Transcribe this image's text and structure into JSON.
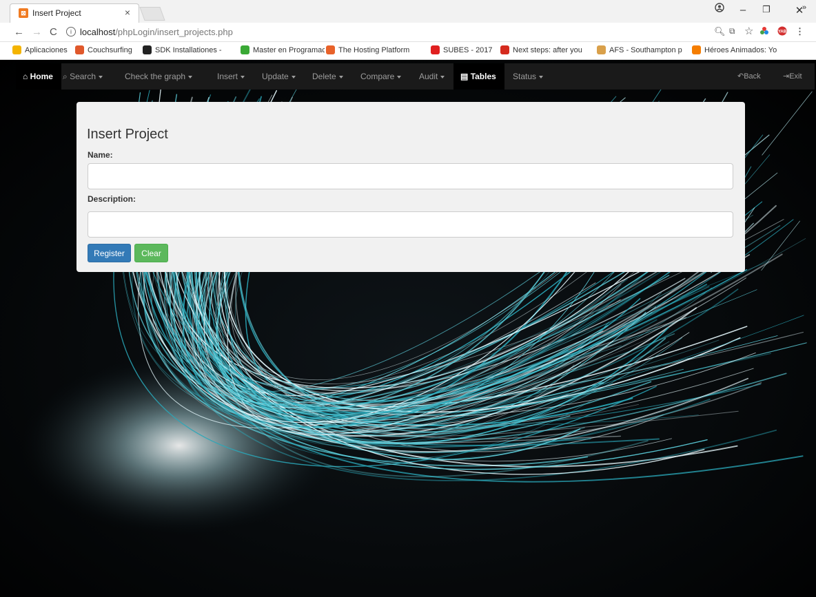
{
  "browser": {
    "tab_title": "Insert Project",
    "tab_close": "×",
    "url_host": "localhost",
    "url_path": "/phpLogin/insert_projects.php",
    "window_controls": {
      "minimize": "–",
      "maximize": "❐",
      "close": "✕"
    },
    "bookmarks": [
      {
        "label": "Aplicaciones",
        "icon": "apps-grid-icon",
        "color": "#f4b400"
      },
      {
        "label": "Couchsurfing",
        "icon": "couchsurfing-icon",
        "color": "#e0582b"
      },
      {
        "label": "SDK Installationes - ",
        "icon": "sdk-icon",
        "color": "#222222"
      },
      {
        "label": "Master en Programac",
        "icon": "master-icon",
        "color": "#3aa935"
      },
      {
        "label": "The Hosting Platform",
        "icon": "hosting-icon",
        "color": "#e8622a"
      },
      {
        "label": "SUBES - 2017",
        "icon": "subes-icon",
        "color": "#e02020"
      },
      {
        "label": "Next steps: after you",
        "icon": "maple-leaf-icon",
        "color": "#d52b1e"
      },
      {
        "label": "AFS - Southampton p",
        "icon": "afs-icon",
        "color": "#d9a04a"
      },
      {
        "label": "Héroes Animados: Yo",
        "icon": "blogger-icon",
        "color": "#f57d00"
      }
    ],
    "bookmarks_overflow": "»"
  },
  "navbar": {
    "home": "Home",
    "search": "Search",
    "graph": "Check the graph",
    "insert": "Insert",
    "update": "Update",
    "delete": "Delete",
    "compare": "Compare",
    "audit": "Audit",
    "tables": "Tables",
    "status": "Status",
    "back": "Back",
    "exit": "Exit"
  },
  "form": {
    "title": "Insert Project",
    "name_label": "Name:",
    "name_value": "",
    "description_label": "Description:",
    "description_value": "",
    "register_button": "Register",
    "clear_button": "Clear"
  }
}
